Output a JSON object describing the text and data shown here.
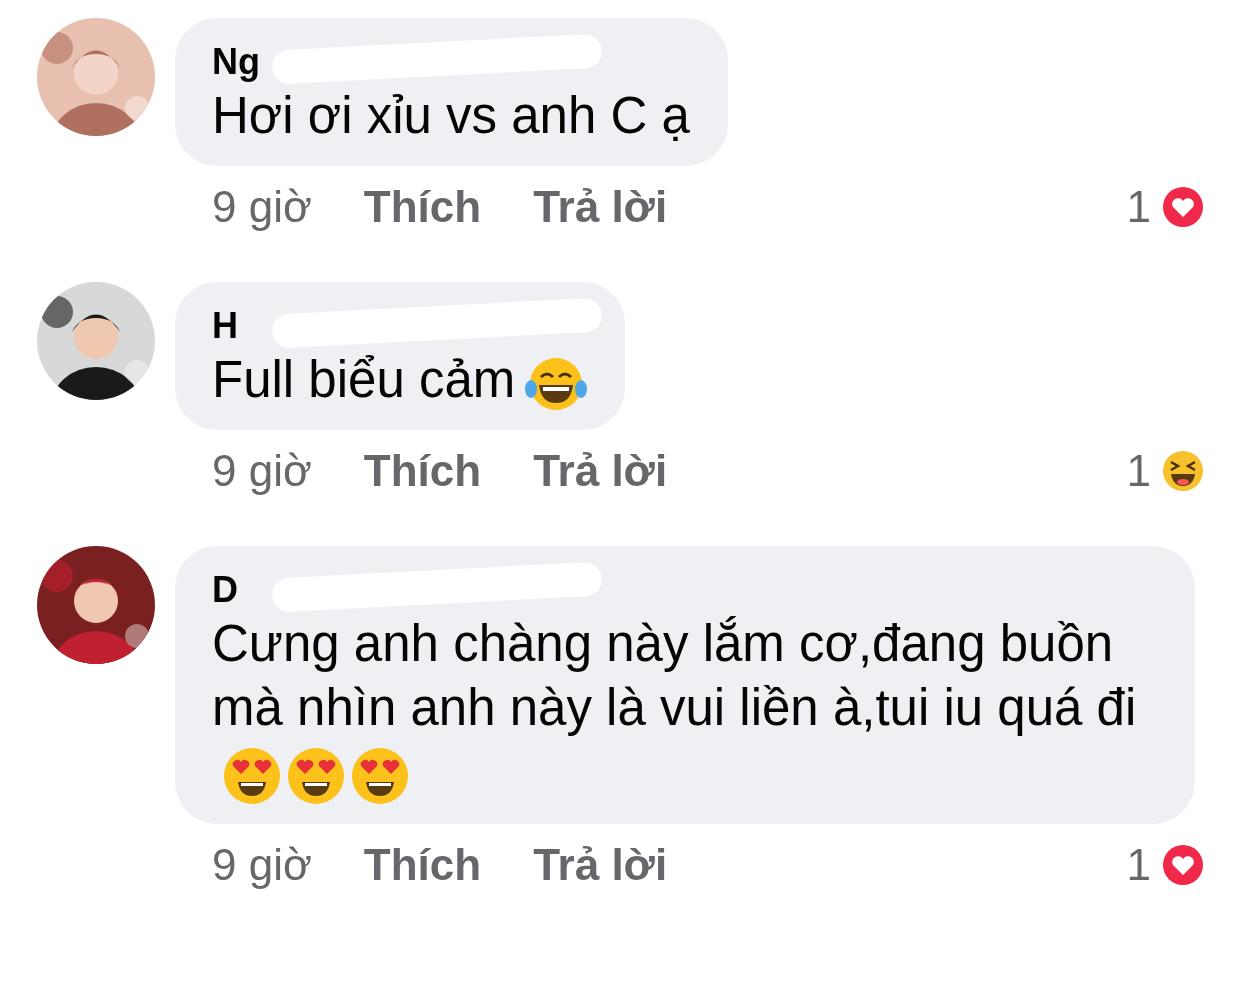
{
  "comments": [
    {
      "name": "Ng",
      "name_redacted": true,
      "text": "Hơi ơi xỉu vs anh C ạ",
      "time": "9 giờ",
      "like": "Thích",
      "reply": "Trả lời",
      "reaction_count": "1",
      "reaction": {
        "kind": "love"
      }
    },
    {
      "name": "H",
      "name_redacted": true,
      "text": "Full biểu cảm",
      "emojis": [
        {
          "kind": "tears-of-joy"
        }
      ],
      "time": "9 giờ",
      "like": "Thích",
      "reply": "Trả lời",
      "reaction_count": "1",
      "reaction": {
        "kind": "haha"
      }
    },
    {
      "name": "D",
      "name_redacted": true,
      "text": "Cưng anh chàng này lắm cơ,đang buồn mà nhìn anh này là vui liền à,tui iu quá đi",
      "emojis": [
        {
          "kind": "heart-eyes"
        },
        {
          "kind": "heart-eyes"
        },
        {
          "kind": "heart-eyes"
        }
      ],
      "time": "9 giờ",
      "like": "Thích",
      "reply": "Trả lời",
      "reaction_count": "1",
      "reaction": {
        "kind": "love"
      }
    }
  ]
}
